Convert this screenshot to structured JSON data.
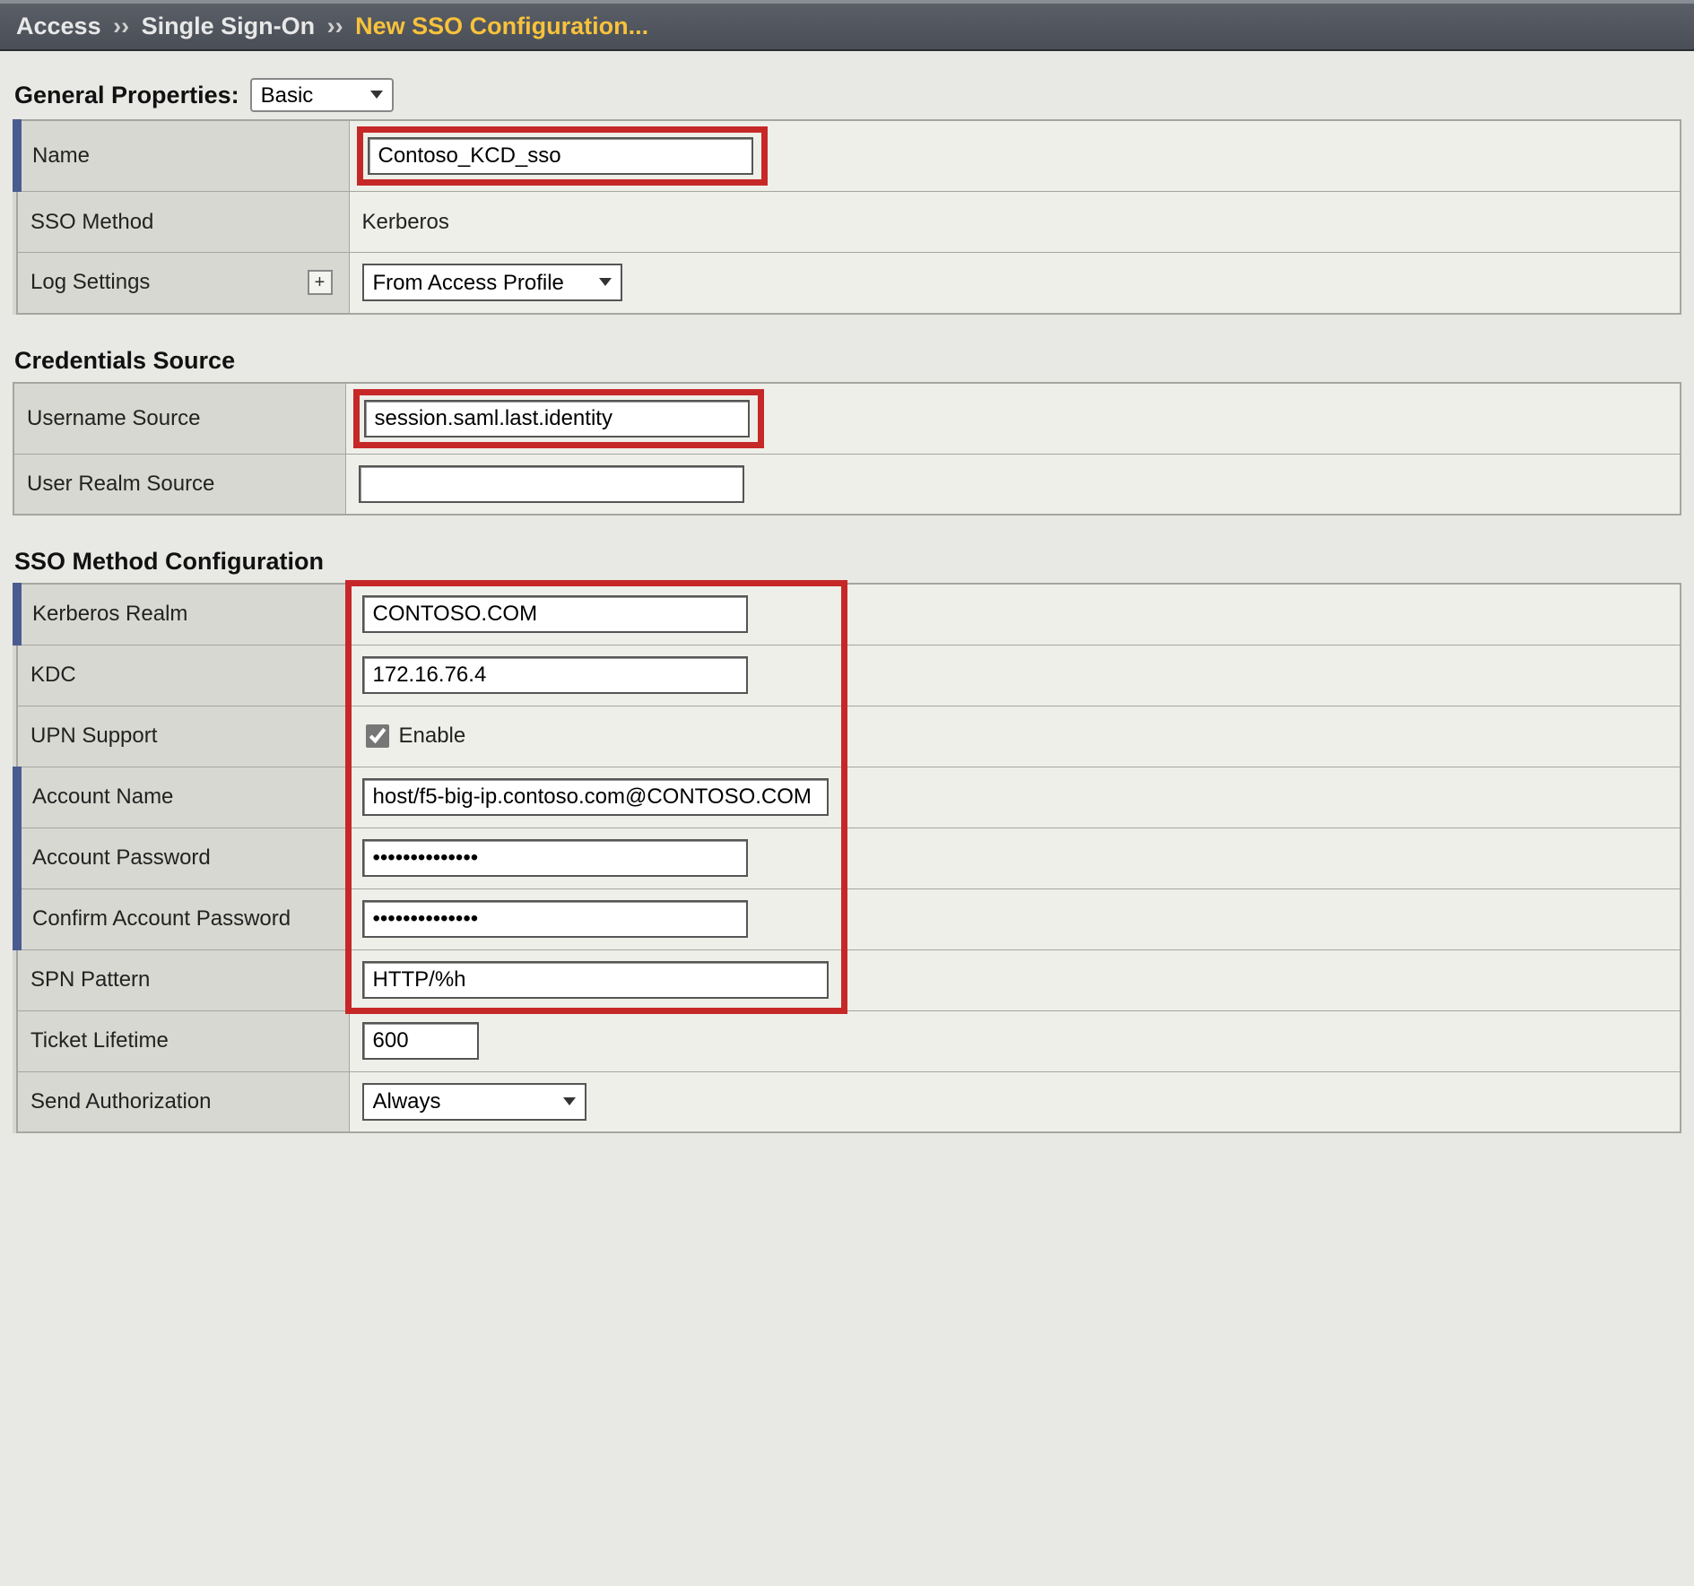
{
  "breadcrumb": {
    "level1": "Access",
    "level2": "Single Sign-On",
    "current": "New SSO Configuration..."
  },
  "sections": {
    "general": {
      "title": "General Properties:",
      "mode": "Basic",
      "rows": {
        "name": {
          "label": "Name",
          "value": "Contoso_KCD_sso"
        },
        "sso_method": {
          "label": "SSO Method",
          "value": "Kerberos"
        },
        "log_settings": {
          "label": "Log Settings",
          "value": "From Access Profile",
          "plus": "+"
        }
      }
    },
    "credentials": {
      "title": "Credentials Source",
      "rows": {
        "username_source": {
          "label": "Username Source",
          "value": "session.saml.last.identity"
        },
        "user_realm_source": {
          "label": "User Realm Source",
          "value": ""
        }
      }
    },
    "method": {
      "title": "SSO Method Configuration",
      "rows": {
        "kerberos_realm": {
          "label": "Kerberos Realm",
          "value": "CONTOSO.COM"
        },
        "kdc": {
          "label": "KDC",
          "value": "172.16.76.4"
        },
        "upn_support": {
          "label": "UPN Support",
          "checkbox_label": "Enable",
          "checked": true
        },
        "account_name": {
          "label": "Account Name",
          "value": "host/f5-big-ip.contoso.com@CONTOSO.COM"
        },
        "account_pw": {
          "label": "Account Password",
          "value": "••••••••••••••"
        },
        "confirm_pw": {
          "label": "Confirm Account Password",
          "value": "••••••••••••••"
        },
        "spn_pattern": {
          "label": "SPN Pattern",
          "value": "HTTP/%h"
        },
        "ticket_lifetime": {
          "label": "Ticket Lifetime",
          "value": "600"
        },
        "send_auth": {
          "label": "Send Authorization",
          "value": "Always"
        }
      }
    }
  }
}
